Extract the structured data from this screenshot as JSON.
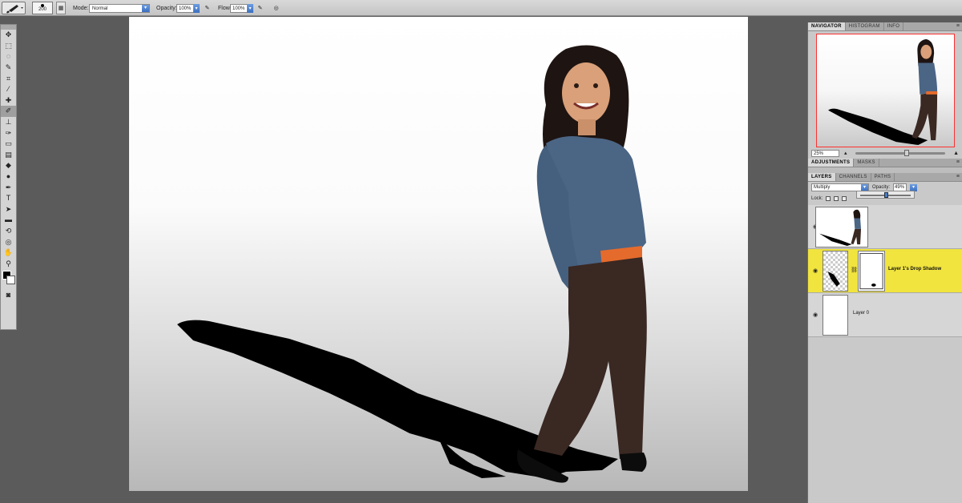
{
  "options_bar": {
    "brush_size": "200",
    "mode_label": "Mode:",
    "mode_value": "Normal",
    "opacity_label": "Opacity:",
    "opacity_value": "100%",
    "flow_label": "Flow:",
    "flow_value": "100%"
  },
  "toolbox": {
    "tools": [
      {
        "name": "move-tool",
        "glyph": "✥"
      },
      {
        "name": "marquee-tool",
        "glyph": "⬚"
      },
      {
        "name": "lasso-tool",
        "glyph": "◌"
      },
      {
        "name": "quick-selection-tool",
        "glyph": "✎"
      },
      {
        "name": "crop-tool",
        "glyph": "⌗"
      },
      {
        "name": "eyedropper-tool",
        "glyph": "⁄"
      },
      {
        "name": "healing-brush-tool",
        "glyph": "✚"
      },
      {
        "name": "brush-tool",
        "glyph": "✐",
        "active": true
      },
      {
        "name": "clone-stamp-tool",
        "glyph": "⊥"
      },
      {
        "name": "history-brush-tool",
        "glyph": "✑"
      },
      {
        "name": "eraser-tool",
        "glyph": "▭"
      },
      {
        "name": "gradient-tool",
        "glyph": "▤"
      },
      {
        "name": "blur-tool",
        "glyph": "◆"
      },
      {
        "name": "dodge-tool",
        "glyph": "●"
      },
      {
        "name": "pen-tool",
        "glyph": "✒"
      },
      {
        "name": "type-tool",
        "glyph": "T"
      },
      {
        "name": "path-selection-tool",
        "glyph": "➤"
      },
      {
        "name": "shape-tool",
        "glyph": "▬"
      },
      {
        "name": "3d-rotate-tool",
        "glyph": "⟲"
      },
      {
        "name": "3d-orbit-tool",
        "glyph": "◎"
      },
      {
        "name": "hand-tool",
        "glyph": "✋"
      },
      {
        "name": "zoom-tool",
        "glyph": "⚲"
      }
    ]
  },
  "colors": {
    "foreground": "#000000",
    "background": "#ffffff",
    "selected_layer": "#f1e43e"
  },
  "navigator": {
    "tabs": [
      "NAVIGATOR",
      "HISTOGRAM",
      "INFO"
    ],
    "zoom": "25%"
  },
  "adjustments": {
    "tabs": [
      "ADJUSTMENTS",
      "MASKS"
    ]
  },
  "layers_panel": {
    "tabs": [
      "LAYERS",
      "CHANNELS",
      "PATHS"
    ],
    "blend_mode": "Multiply",
    "opacity_label": "Opacity:",
    "opacity_value": "49%",
    "lock_label": "Lock:",
    "layers": [
      {
        "name": ""
      },
      {
        "name": "Layer 1's Drop Shadow"
      },
      {
        "name": "Layer 0"
      }
    ]
  }
}
